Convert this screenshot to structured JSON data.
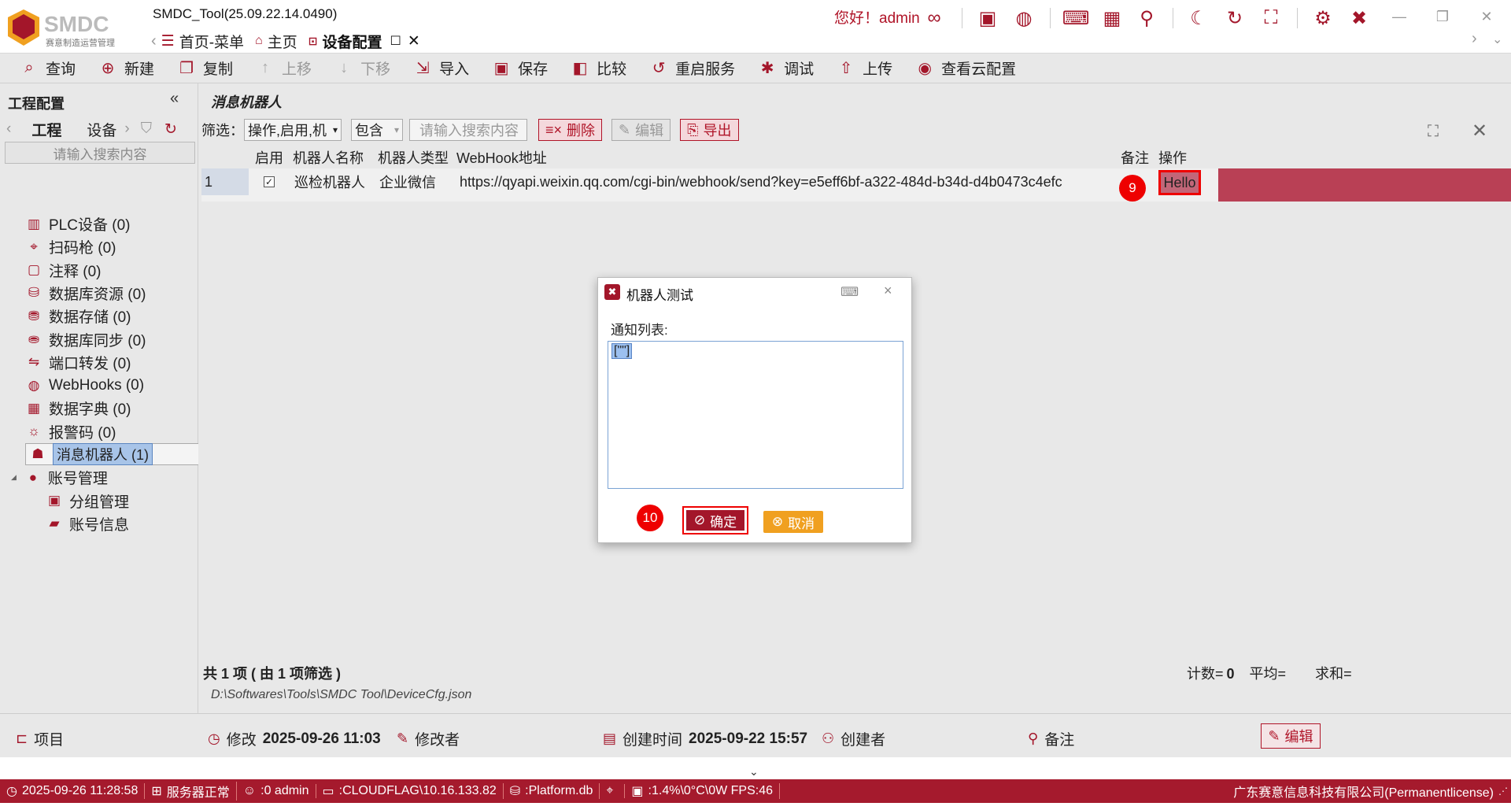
{
  "app": {
    "logo_text": "SMDC",
    "logo_sub": "赛意制造运营管理",
    "version_title": "SMDC_Tool(25.09.22.14.0490)",
    "greeting": "您好！admin"
  },
  "tabs": [
    {
      "label": "首页-菜单"
    },
    {
      "label": "主页"
    },
    {
      "label": "设备配置"
    }
  ],
  "toolbar": {
    "items": [
      {
        "label": "查询",
        "icon": "search-icon",
        "enabled": true
      },
      {
        "label": "新建",
        "icon": "plus-circle-icon",
        "enabled": true
      },
      {
        "label": "复制",
        "icon": "copy-icon",
        "enabled": true
      },
      {
        "label": "上移",
        "icon": "arrow-up-icon",
        "enabled": false
      },
      {
        "label": "下移",
        "icon": "arrow-down-icon",
        "enabled": false
      },
      {
        "label": "导入",
        "icon": "import-icon",
        "enabled": true
      },
      {
        "label": "保存",
        "icon": "save-icon",
        "enabled": true
      },
      {
        "label": "比较",
        "icon": "compare-icon",
        "enabled": true
      },
      {
        "label": "重启服务",
        "icon": "restart-icon",
        "enabled": true
      },
      {
        "label": "调试",
        "icon": "bug-icon",
        "enabled": true
      },
      {
        "label": "上传",
        "icon": "upload-icon",
        "enabled": true
      },
      {
        "label": "查看云配置",
        "icon": "eye-icon",
        "enabled": true
      }
    ]
  },
  "left_panel": {
    "title": "工程配置",
    "tab_project": "工程",
    "tab_device": "设备",
    "search_placeholder": "请输入搜索内容",
    "tree": [
      {
        "label": "PLC设备 (0)",
        "icon": "plc-icon"
      },
      {
        "label": "扫码枪 (0)",
        "icon": "scanner-icon"
      },
      {
        "label": "注释 (0)",
        "icon": "comment-icon"
      },
      {
        "label": "数据库资源 (0)",
        "icon": "database-icon"
      },
      {
        "label": "数据存储 (0)",
        "icon": "database-store-icon"
      },
      {
        "label": "数据库同步 (0)",
        "icon": "database-sync-icon"
      },
      {
        "label": "端口转发 (0)",
        "icon": "port-forward-icon"
      },
      {
        "label": "WebHooks (0)",
        "icon": "globe-icon"
      },
      {
        "label": "数据字典 (0)",
        "icon": "table-icon"
      },
      {
        "label": "报警码 (0)",
        "icon": "alarm-icon"
      },
      {
        "label": "消息机器人 (1)",
        "icon": "robot-icon"
      },
      {
        "label": "账号管理",
        "icon": "user-icon"
      },
      {
        "label": "分组管理",
        "icon": "group-icon"
      },
      {
        "label": "账号信息",
        "icon": "account-info-icon"
      }
    ]
  },
  "main": {
    "header": "消息机器人",
    "filter_label": "筛选：",
    "filter_fields": "操作,启用,机",
    "filter_op": "包含",
    "filter_placeholder": "请输入搜索内容",
    "btn_delete": "删除",
    "btn_edit": "编辑",
    "btn_export": "导出",
    "columns": [
      "启用",
      "机器人名称",
      "机器人类型",
      "WebHook地址",
      "备注",
      "操作"
    ],
    "rows": [
      {
        "index": "1",
        "enabled": true,
        "name": "巡检机器人",
        "type": "企业微信",
        "webhook": "https://qyapi.weixin.qq.com/cgi-bin/webhook/send?key=e5eff6bf-a322-484d-b34d-d4b0473c4efc",
        "remark": "",
        "action": "Hello"
      }
    ],
    "summary": "共 1 项 ( 由 1 项筛选 )",
    "stats_count_label": "计数=",
    "stats_count": "0",
    "stats_avg_label": "平均=",
    "stats_sum_label": "求和=",
    "path": "D:\\Softwares\\Tools\\SMDC Tool\\DeviceCfg.json"
  },
  "details": {
    "project_label": "项目",
    "modified_label": "修改",
    "modified_time": "2025-09-26 11:03",
    "modifier_label": "修改者",
    "created_label": "创建时间",
    "created_time": "2025-09-22 15:57",
    "creator_label": "创建者",
    "remark_label": "备注",
    "edit_label": "编辑"
  },
  "status": {
    "time": "2025-09-26 11:28:58",
    "server": "服务器正常",
    "user": ":0 admin",
    "host": ":CLOUDFLAG\\10.16.133.82",
    "db": ":Platform.db",
    "perf": ":1.4%\\0°C\\0W  FPS:46",
    "company": "广东赛意信息科技有限公司(Permanentlicense)"
  },
  "dialog": {
    "title": "机器人测试",
    "label": "通知列表:",
    "value": "[\"\"]",
    "ok": "确定",
    "cancel": "取消"
  },
  "badges": {
    "b9": "9",
    "b10": "10"
  },
  "colors": {
    "brand": "#a3162a",
    "status_bar": "#a51a2d",
    "row_highlight": "#b94055",
    "cancel": "#f0a020",
    "badge": "#e00000"
  }
}
